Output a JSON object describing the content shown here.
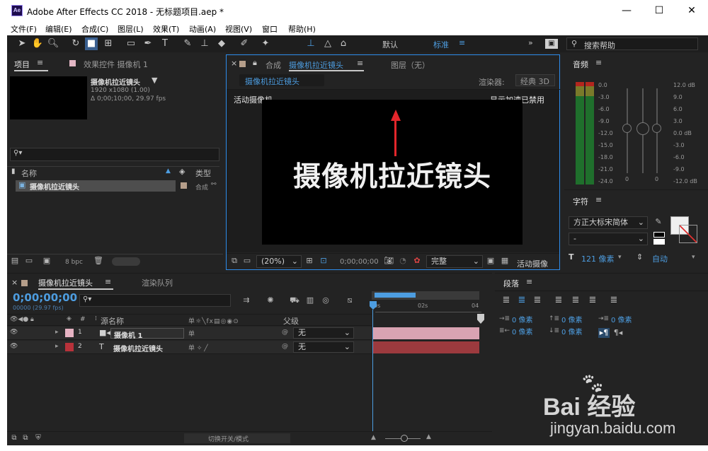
{
  "window": {
    "title": "Adobe After Effects CC 2018 - 无标题项目.aep *",
    "logo": "Ae",
    "minimize": "—",
    "maximize": "☐",
    "close": "✕"
  },
  "menu": [
    "文件(F)",
    "编辑(E)",
    "合成(C)",
    "图层(L)",
    "效果(T)",
    "动画(A)",
    "视图(V)",
    "窗口",
    "帮助(H)"
  ],
  "toolbar": {
    "workspace_default": "默认",
    "workspace_standard": "标准",
    "search_placeholder": "搜索帮助",
    "more": "»"
  },
  "project": {
    "tab_project": "项目",
    "tab_effects": "效果控件 摄像机 1",
    "item_name": "摄像机拉近镜头",
    "item_size": "1920 x1080 (1.00)",
    "item_duration": "Δ 0;00;10;00, 29.97 fps",
    "col_name": "名称",
    "col_type": "类型",
    "row_name": "摄像机拉近镜头",
    "row_type": "合成",
    "bpc": "8 bpc"
  },
  "composition": {
    "tab_label": "合成",
    "tab_name": "摄像机拉近镜头",
    "layer_tab": "图层（无）",
    "subtab": "摄像机拉近镜头",
    "renderer_label": "渲染器:",
    "renderer_value": "经典 3D",
    "active_camera": "活动摄像机",
    "accel_disabled": "显示加速已禁用",
    "canvas_text": "摄像机拉近镜头",
    "zoom": "(20%)",
    "timecode": "0;00;00;00",
    "resolution": "完整",
    "camera_view": "活动摄像"
  },
  "audio": {
    "title": "音频",
    "left_scale": [
      "0.0",
      "-3.0",
      "-6.0",
      "-9.0",
      "-12.0",
      "-15.0",
      "-18.0",
      "-21.0",
      "-24.0"
    ],
    "right_scale": [
      "12.0 dB",
      "9.0",
      "6.0",
      "3.0",
      "0.0 dB",
      "-3.0",
      "-6.0",
      "-9.0",
      "-12.0 dB"
    ],
    "zero_left": "0",
    "zero_right": "0"
  },
  "character": {
    "title": "字符",
    "font": "方正大标宋简体",
    "style": "-",
    "size_value": "121 像素",
    "leading": "自动"
  },
  "paragraph": {
    "title": "段落",
    "indent_left": "0 像素",
    "indent_first": "0 像素",
    "indent_right": "0 像素",
    "space_before": "0 像素",
    "space_after": "0 像素"
  },
  "timeline": {
    "tab_comp": "摄像机拉近镜头",
    "tab_render": "渲染队列",
    "timecode": "0;00;00;00",
    "frame_info": "00000 (29.97 fps)",
    "col_source": "源名称",
    "col_parent": "父级",
    "col_num": "#",
    "ruler": [
      "0s",
      "02s",
      "04"
    ],
    "layers": [
      {
        "num": "1",
        "name": "摄像机 1",
        "parent": "无",
        "color": "#e6b3c3",
        "bar": "#d9a3b2"
      },
      {
        "num": "2",
        "name": "摄像机拉近镜头",
        "parent": "无",
        "color": "#b8323a",
        "bar": "#9c3a3e"
      }
    ],
    "footer": "切换开关/模式"
  },
  "watermark": {
    "brand": "Bai 经验",
    "url": "jingyan.baidu.com"
  }
}
